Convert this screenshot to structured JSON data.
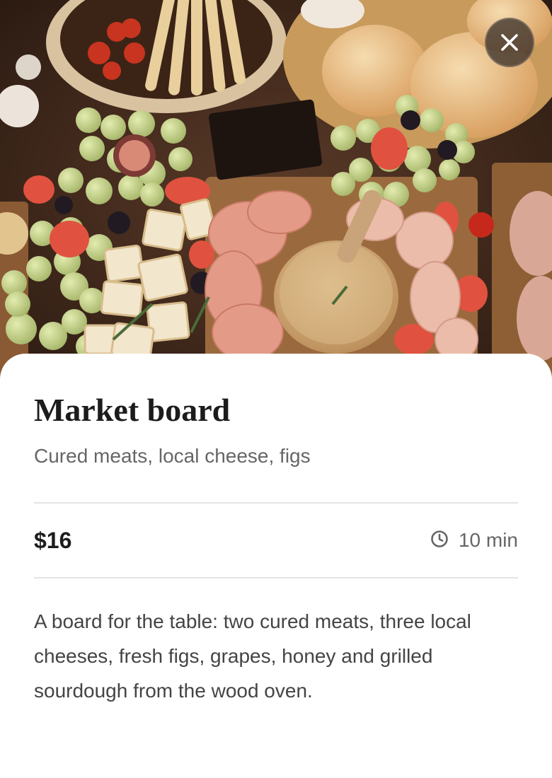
{
  "dish": {
    "name": "Market board",
    "tagline": "Cured meats, local cheese, figs",
    "price": "$16",
    "prep_time": "10 min",
    "description": "A board for the table: two cured meats, three local cheeses, fresh figs, grapes, honey and grilled sourdough from the wood oven."
  },
  "icons": {
    "close": "close-icon",
    "time": "clock-icon"
  },
  "colors": {
    "title": "#1c1c1c",
    "muted": "#666666",
    "body": "#444444",
    "divider": "#e4e4e4",
    "close_bg": "#3c322c"
  }
}
